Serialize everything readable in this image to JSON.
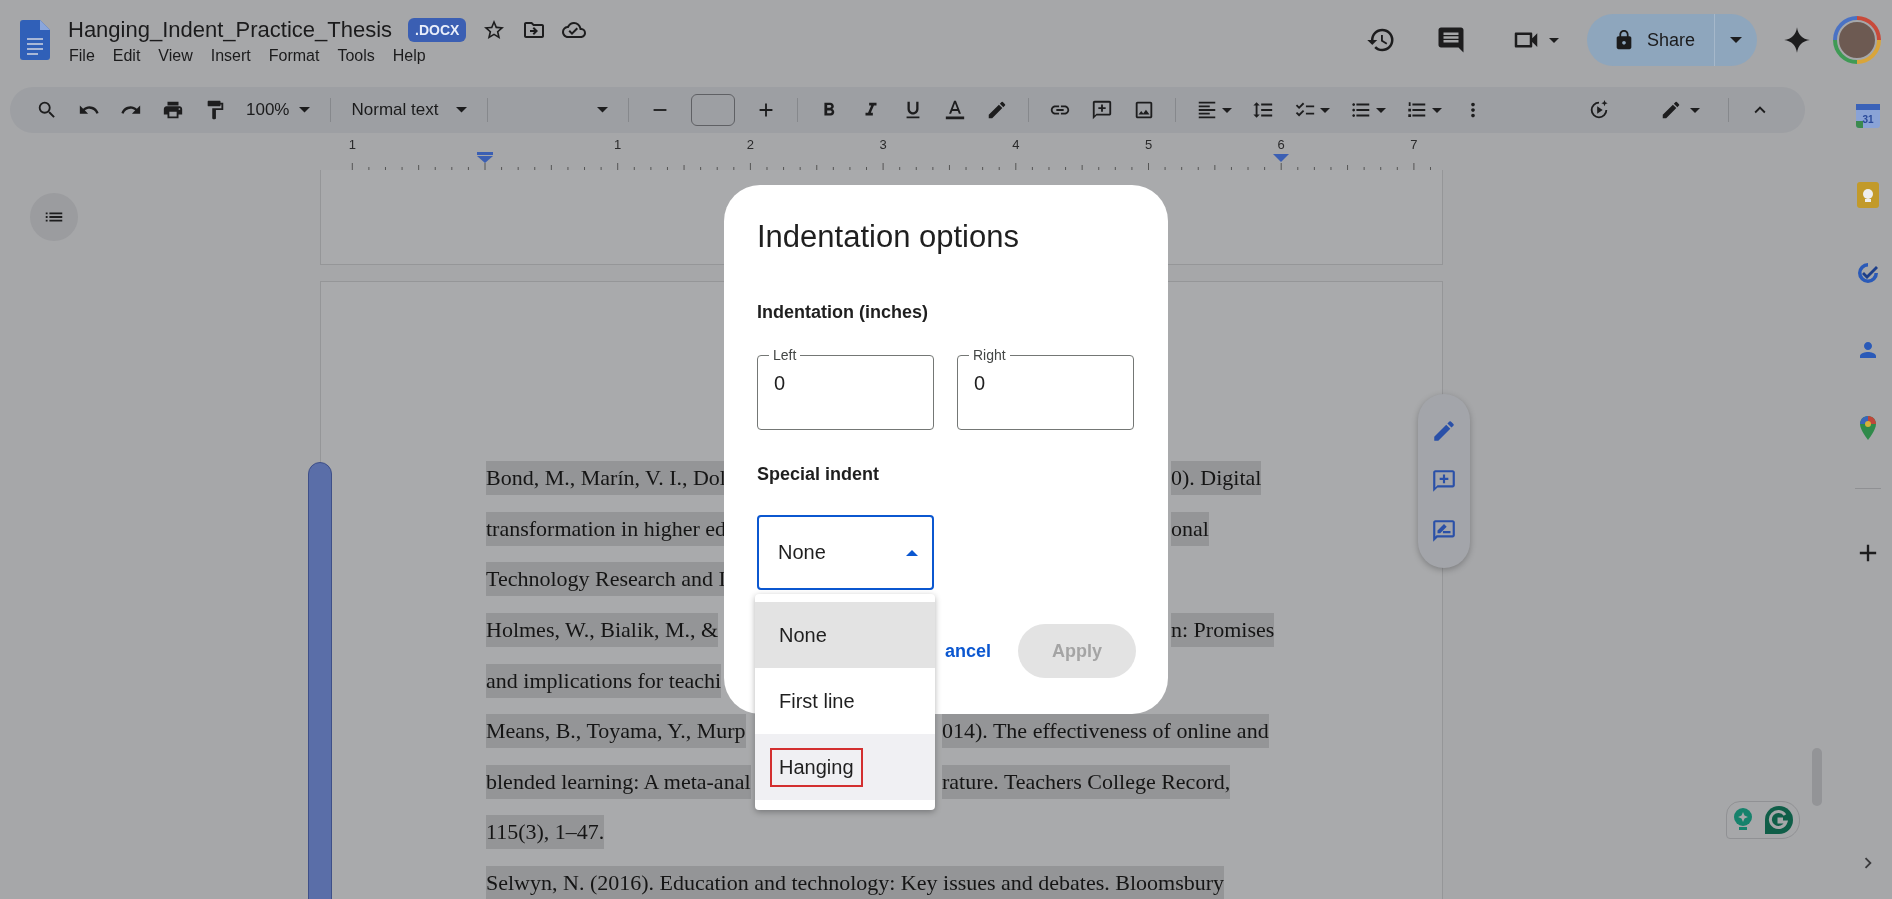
{
  "document": {
    "title": "Hanging_Indent_Practice_Thesis",
    "badge": ".DOCX"
  },
  "menu": [
    "File",
    "Edit",
    "View",
    "Insert",
    "Format",
    "Tools",
    "Help"
  ],
  "share": {
    "label": "Share"
  },
  "toolbar": {
    "zoom": "100%",
    "style": "Normal text"
  },
  "ruler": {
    "labels": [
      "1",
      "1",
      "2",
      "3",
      "4",
      "5",
      "6",
      "7"
    ]
  },
  "sidebar": {
    "calendar_day": "31"
  },
  "page_lines": [
    {
      "left": "Bond, M., Marín, V. I., Dol",
      "right": "0). Digital",
      "selected": true
    },
    {
      "left": "transformation in higher ed",
      "right": "onal",
      "selected": true
    },
    {
      "left": "Technology Research and I",
      "selected": true
    },
    {
      "left": "Holmes, W., Bialik, M., &",
      "right": "n: Promises",
      "selected": true
    },
    {
      "left": "and implications for teachi",
      "selected": true
    },
    {
      "left": "Means, B., Toyama, Y., Murp",
      "right": "014). The effectiveness of online and",
      "selected": true
    },
    {
      "left": "blended learning: A meta-anal",
      "right": "rature. Teachers College Record,",
      "selected": true
    },
    {
      "left": "115(3), 1–47.",
      "selected": true
    },
    {
      "left": "Selwyn, N. (2016). Education and technology: Key issues and debates. Bloomsbury",
      "selected": true
    }
  ],
  "dialog": {
    "title": "Indentation options",
    "indentation_heading": "Indentation (inches)",
    "fields": [
      {
        "label": "Left",
        "value": "0"
      },
      {
        "label": "Right",
        "value": "0"
      }
    ],
    "special_heading": "Special indent",
    "select": {
      "value": "None",
      "expanded": true
    },
    "options": [
      {
        "label": "None",
        "selected": true,
        "hovered": false,
        "outlined": false
      },
      {
        "label": "First line",
        "selected": false,
        "hovered": false,
        "outlined": false
      },
      {
        "label": "Hanging",
        "selected": false,
        "hovered": true,
        "outlined": true
      }
    ],
    "buttons": [
      {
        "label": "ancel",
        "kind": "text",
        "disabled": false
      },
      {
        "label": "Apply",
        "kind": "filled",
        "disabled": true
      }
    ]
  }
}
